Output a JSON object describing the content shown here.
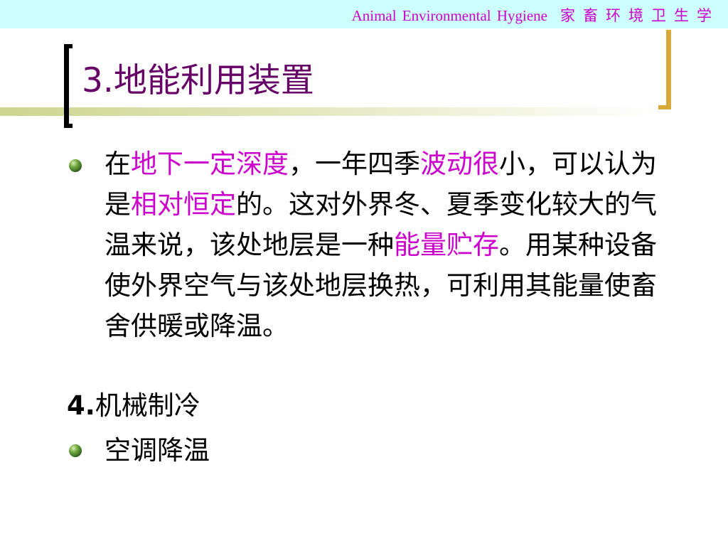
{
  "header": {
    "course_en": "Animal  Environmental  Hygiene",
    "course_cn": "家畜环境卫生学"
  },
  "title": "3.地能利用装置",
  "bullet1": {
    "t1": "在",
    "h1": "地下一定深度",
    "t2": "，一年四季",
    "h2": "波动很",
    "t3": "小，可以认为是",
    "h3": "相对恒定",
    "t4": "的。这对外界冬、夏季变化较大的气温来说，该处地层是一种",
    "h4": "能量贮存",
    "t5": "。用某种设备使外界空气与该处地层换热，可利用其能量使畜舍供暖或降温。"
  },
  "section4": {
    "number": "4.",
    "label": "机械制冷"
  },
  "bullet2": {
    "text": "空调降温"
  },
  "colors": {
    "header_band": "#ccffff",
    "header_text": "#cc00cc",
    "title": "#660066",
    "highlight": "#cc00cc",
    "bracket_left": "#000000",
    "bracket_right": "#d9a83a",
    "rule": "#ccd58e"
  },
  "icons": {
    "bullet": "green-sphere-bullet-icon"
  }
}
